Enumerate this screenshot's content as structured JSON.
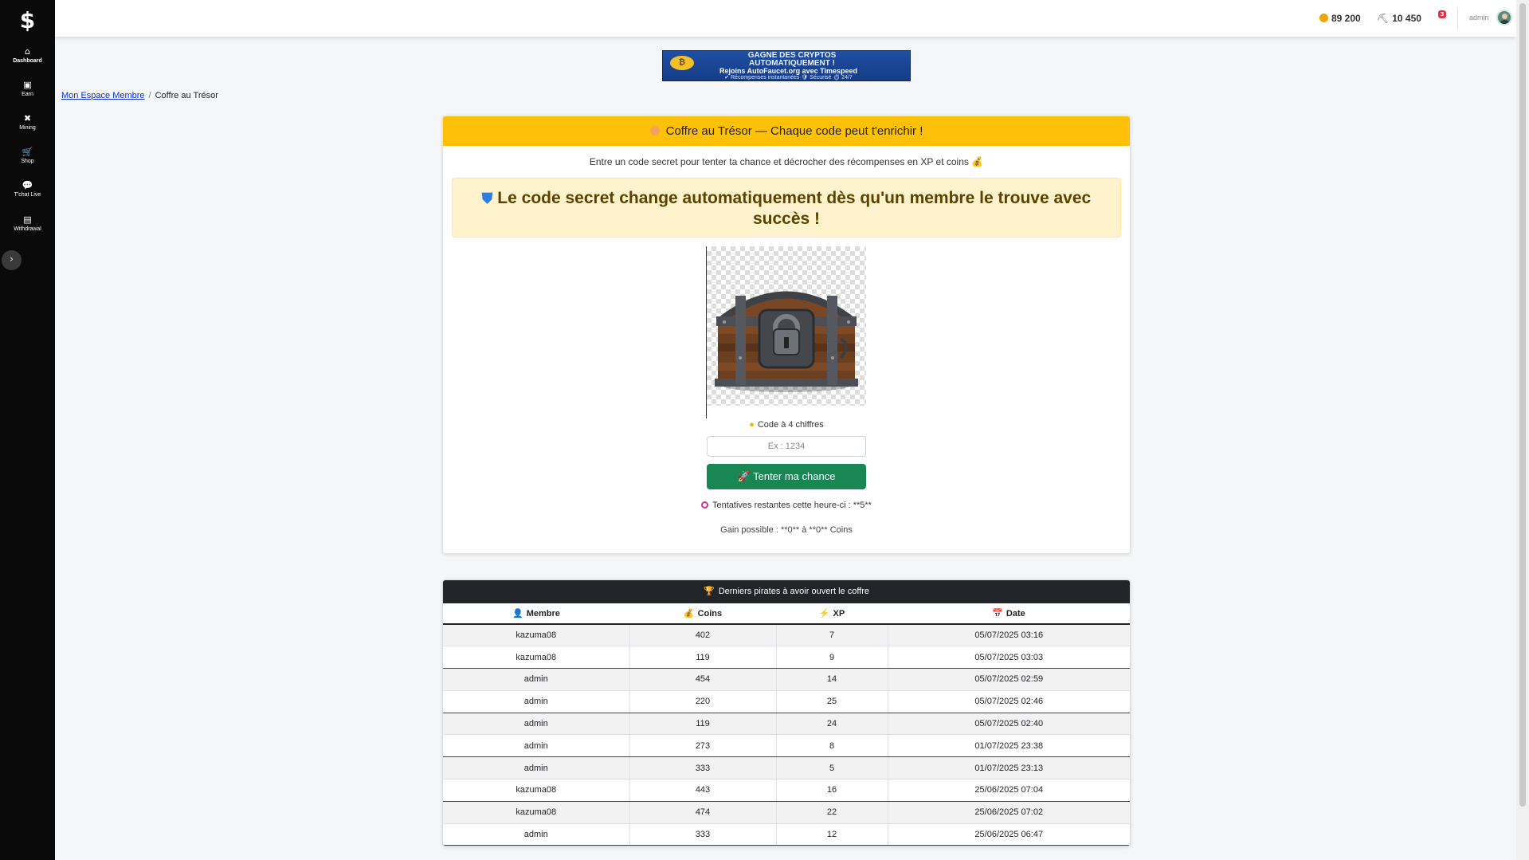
{
  "sidebar": {
    "logo": "$",
    "items": [
      {
        "label": "Dashboard",
        "icon": "⌂"
      },
      {
        "label": "Earn",
        "icon": "▣"
      },
      {
        "label": "Mining",
        "icon": "✖"
      },
      {
        "label": "Shop",
        "icon": "🛒"
      },
      {
        "label": "T'chat Live",
        "icon": "💬"
      },
      {
        "label": "Withdrawal",
        "icon": "▤"
      }
    ],
    "collapse_icon": "›"
  },
  "topbar": {
    "coins": "89 200",
    "mining": "10 450",
    "notifications_count": "3",
    "username": "admin"
  },
  "ad": {
    "line1": "GAGNE DES CRYPTOS",
    "line1b": "AUTOMATIQUEMENT !",
    "line2": "Rejoins AutoFaucet.org avec Timespeed",
    "line3": "✔ Récompenses instantanées   🛡 Sécurisé   ⏱ 24/7"
  },
  "breadcrumb": {
    "home": "Mon Espace Membre",
    "separator": "/",
    "current": "Coffre au Trésor"
  },
  "card": {
    "title": "Coffre au Trésor — Chaque code peut t'enrichir !",
    "intro": "Entre un code secret pour tenter ta chance et décrocher des récompenses en XP et coins 💰",
    "alert": "Le code secret change automatiquement dès qu'un membre le trouve avec succès !",
    "code_label": "Code à 4 chiffres",
    "input_placeholder": "Ex : 1234",
    "button_label": "🚀 Tenter ma chance",
    "attempts": "Tentatives restantes cette heure-ci : **5**",
    "gain": "Gain possible : **0** à **0** Coins"
  },
  "table": {
    "title": "Derniers pirates à avoir ouvert le coffre",
    "headers": {
      "member": "Membre",
      "coins": "Coins",
      "xp": "XP",
      "date": "Date"
    },
    "rows": [
      {
        "member": "kazuma08",
        "coins": "402",
        "xp": "7",
        "date": "05/07/2025 03:16"
      },
      {
        "member": "kazuma08",
        "coins": "119",
        "xp": "9",
        "date": "05/07/2025 03:03"
      },
      {
        "member": "admin",
        "coins": "454",
        "xp": "14",
        "date": "05/07/2025 02:59"
      },
      {
        "member": "admin",
        "coins": "220",
        "xp": "25",
        "date": "05/07/2025 02:46"
      },
      {
        "member": "admin",
        "coins": "119",
        "xp": "24",
        "date": "05/07/2025 02:40"
      },
      {
        "member": "admin",
        "coins": "273",
        "xp": "8",
        "date": "01/07/2025 23:38"
      },
      {
        "member": "admin",
        "coins": "333",
        "xp": "5",
        "date": "01/07/2025 23:13"
      },
      {
        "member": "kazuma08",
        "coins": "443",
        "xp": "16",
        "date": "25/06/2025 07:04"
      },
      {
        "member": "kazuma08",
        "coins": "474",
        "xp": "22",
        "date": "25/06/2025 07:02"
      },
      {
        "member": "admin",
        "coins": "333",
        "xp": "12",
        "date": "25/06/2025 06:47"
      }
    ]
  },
  "colors": {
    "sidebar_bg": "#0a0a0a",
    "header_yellow": "#ffc107",
    "alert_bg": "#fff3cd",
    "button_green": "#198754",
    "table_header_dark": "#212529"
  }
}
